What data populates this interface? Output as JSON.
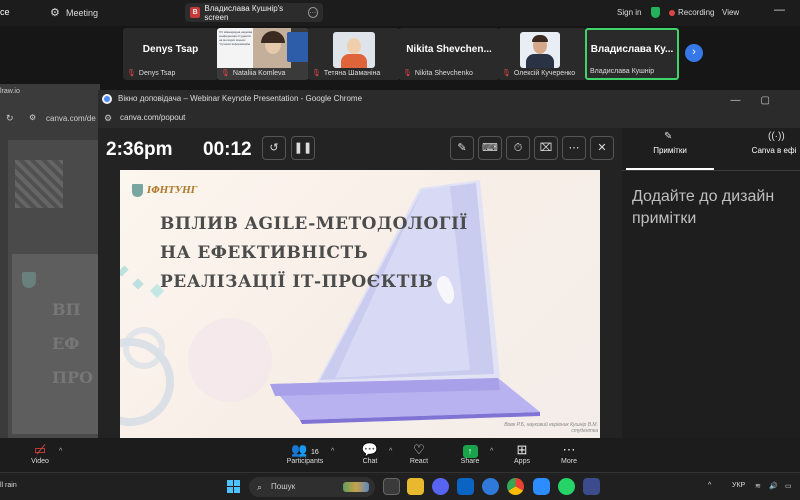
{
  "topbar": {
    "left_fragment": "ce",
    "meeting_label": "Meeting",
    "share_pill": {
      "badge": "B",
      "label": "Владислава Кушнір's screen"
    },
    "signin": "Sign in",
    "recording": "Recording",
    "view": "View"
  },
  "participants": [
    {
      "big": "Denys Tsap",
      "name": "Denys Tsap"
    },
    {
      "big": "",
      "name": "Nataliia Komleva",
      "thumb_text": "XV міжнародна наукова конференція студентів на молодих вчених \"Сучасні Інформаційні"
    },
    {
      "big": "",
      "name": "Тетяна Шаманіна"
    },
    {
      "big": "Nikita  Shevchen...",
      "name": "Nikita Shevchenko"
    },
    {
      "big": "",
      "name": "Олексій Кучеренко"
    },
    {
      "big": "Владислава  Ку...",
      "name": "Владислава Кушнір"
    }
  ],
  "background_app": {
    "title_fragment": "lraw.io",
    "url_fragment": "canva.com/de",
    "card_fragments": [
      "ВП",
      "ЕФ",
      "ПРО"
    ]
  },
  "window": {
    "title": "Вікно доповідача – Webinar Keynote Presentation - Google Chrome",
    "url": "canva.com/popout"
  },
  "presenter": {
    "clock": "2:36pm",
    "timer": "00:12"
  },
  "slide": {
    "logo_text": "ІФНТУНГ",
    "title": "ВПЛИВ AGILE-МЕТОДОЛОГІЇ НА ЕФЕКТИВНІСТЬ РЕАЛІЗАЦІЇ ІТ-ПРОЄКТІВ",
    "credit": "Вовк Р.Б, науковий керівник Кушнір В.М. студентка"
  },
  "sidebar": {
    "tab_notes": "Примітки",
    "tab_canva": "Canva в ефі",
    "notes_placeholder_line1": "Додайте до дизайн",
    "notes_placeholder_line2": "примітки"
  },
  "bottombar": {
    "video": "Video",
    "participants": "Participants",
    "participant_count": "16",
    "chat": "Chat",
    "react": "React",
    "share": "Share",
    "apps": "Apps",
    "more": "More"
  },
  "taskbar": {
    "weather": "ll rain",
    "search_placeholder": "Пошук",
    "lang": "УКР"
  },
  "colors": {
    "accent_blue": "#3778e8",
    "active_green": "#3fd36b",
    "record_red": "#e04545",
    "share_green": "#19a34a"
  }
}
